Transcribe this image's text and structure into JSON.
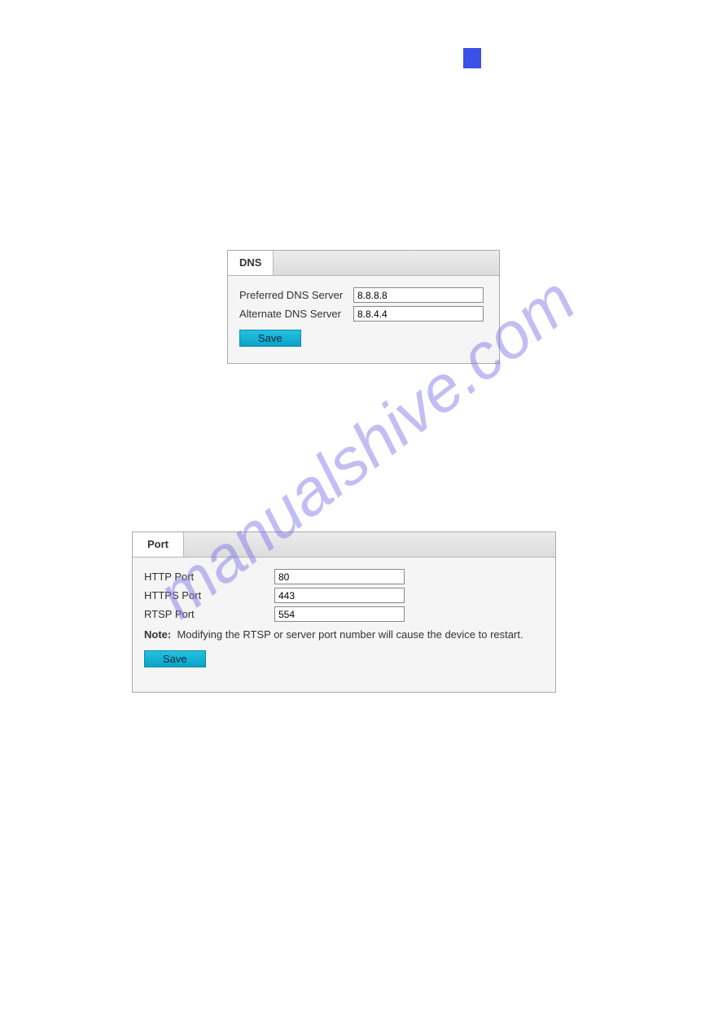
{
  "watermark": "manualshive.com",
  "dns_panel": {
    "tab_label": "DNS",
    "preferred_label": "Preferred DNS Server",
    "preferred_value": "8.8.8.8",
    "alternate_label": "Alternate DNS Server",
    "alternate_value": "8.8.4.4",
    "save_label": "Save"
  },
  "port_panel": {
    "tab_label": "Port",
    "http_label": "HTTP Port",
    "http_value": "80",
    "https_label": "HTTPS Port",
    "https_value": "443",
    "rtsp_label": "RTSP Port",
    "rtsp_value": "554",
    "note_prefix": "Note:",
    "note_text": "Modifying the RTSP or server port number will cause the device to restart.",
    "save_label": "Save"
  }
}
